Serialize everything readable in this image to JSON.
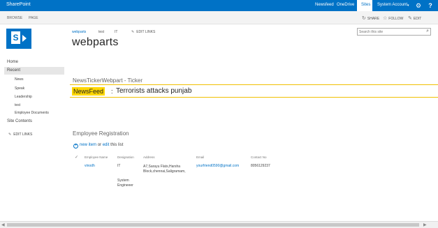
{
  "suite_bar": {
    "brand": "SharePoint",
    "links": [
      "Newsfeed",
      "OneDrive",
      "Sites"
    ],
    "account": "System Account",
    "account_caret": "▾",
    "settings_icon": "gear-icon",
    "help_icon": "help-icon",
    "color": "#0072c6"
  },
  "ribbon": {
    "tabs": [
      "BROWSE",
      "PAGE"
    ],
    "actions": {
      "share": "SHARE",
      "follow": "FOLLOW",
      "edit": "EDIT"
    },
    "help": "?"
  },
  "header": {
    "top_nav": [
      "webparts",
      "test",
      "IT"
    ],
    "edit_links": "EDIT LINKS",
    "site_title": "webparts",
    "search_placeholder": "Search this site"
  },
  "quick_launch": {
    "items": [
      {
        "label": "Home",
        "level": 0
      },
      {
        "label": "Recent",
        "level": 0,
        "selected": true
      },
      {
        "label": "News",
        "level": 1
      },
      {
        "label": "Speak",
        "level": 1
      },
      {
        "label": "Leadership",
        "level": 1
      },
      {
        "label": "test",
        "level": 1
      },
      {
        "label": "Employee Documents",
        "level": 1
      },
      {
        "label": "Site Contents",
        "level": 0
      }
    ],
    "edit_links": "EDIT LINKS"
  },
  "news_ticker": {
    "title": "NewsTickerWebpart - Ticker",
    "label": "NewsFeed",
    "separator": ":",
    "headline": "Terrorists attacks punjab",
    "highlight_color": "#ffd700"
  },
  "employee_registration": {
    "title": "Employee Registration",
    "new_item": "new item",
    "or": "or",
    "edit": "edit",
    "this_list": "this list",
    "columns": [
      "Employee Name",
      "Designation",
      "Address",
      "Email",
      "Contact No"
    ],
    "rows": [
      {
        "name": "vinodh",
        "designation": "IT",
        "designation_2": "System",
        "designation_3": "Engineeer",
        "address_1": "A7,Sarayu Flats,Harsha",
        "address_2": "Block,chennai,Saligramam,",
        "email": "yourfriend0590@gmail.com",
        "contact": "8056129237"
      }
    ]
  }
}
